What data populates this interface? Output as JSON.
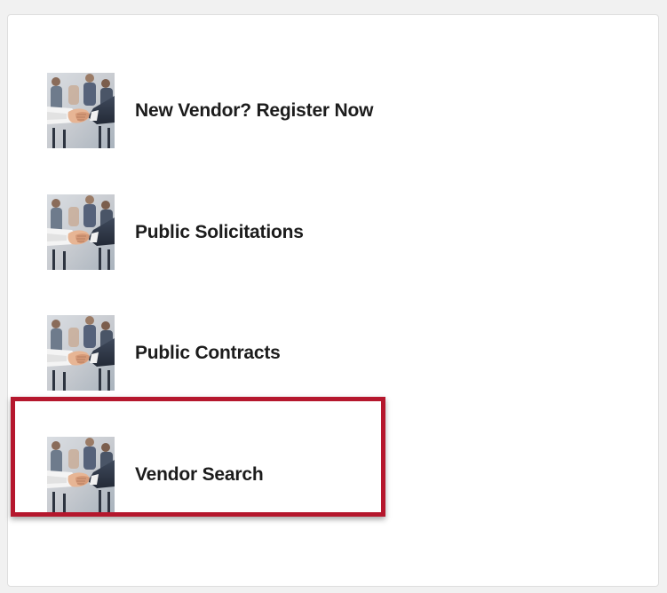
{
  "links": [
    {
      "label": "New Vendor? Register Now",
      "icon": "handshake-icon"
    },
    {
      "label": "Public Solicitations",
      "icon": "handshake-icon"
    },
    {
      "label": "Public Contracts",
      "icon": "handshake-icon"
    },
    {
      "label": "Vendor Search",
      "icon": "handshake-icon"
    }
  ],
  "colors": {
    "highlight": "#b5172d",
    "text": "#1c1c1c"
  }
}
